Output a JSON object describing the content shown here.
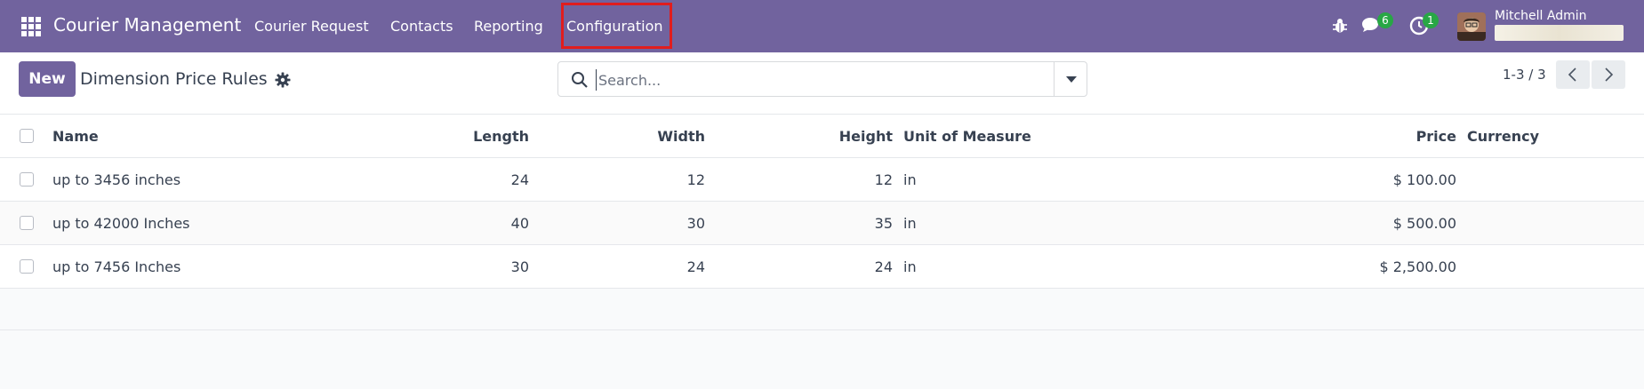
{
  "navbar": {
    "app_name": "Courier Management",
    "menu": [
      "Courier Request",
      "Contacts",
      "Reporting",
      "Configuration"
    ],
    "messages_count": "6",
    "activities_count": "1",
    "user_name": "Mitchell Admin",
    "accent": "#71639e",
    "highlight_color": "#e11d1d"
  },
  "control": {
    "new_label": "New",
    "breadcrumb": "Dimension Price Rules",
    "search_placeholder": "Search...",
    "pager": "1-3 / 3"
  },
  "table": {
    "columns": [
      "Name",
      "Length",
      "Width",
      "Height",
      "Unit of Measure",
      "Price",
      "Currency"
    ],
    "rows": [
      {
        "name": "up to 3456 inches",
        "length": "24",
        "width": "12",
        "height": "12",
        "uom": "in",
        "price": "$ 100.00",
        "currency": ""
      },
      {
        "name": "up to 42000 Inches",
        "length": "40",
        "width": "30",
        "height": "35",
        "uom": "in",
        "price": "$ 500.00",
        "currency": ""
      },
      {
        "name": "up to 7456 Inches",
        "length": "30",
        "width": "24",
        "height": "24",
        "uom": "in",
        "price": "$ 2,500.00",
        "currency": ""
      }
    ]
  }
}
